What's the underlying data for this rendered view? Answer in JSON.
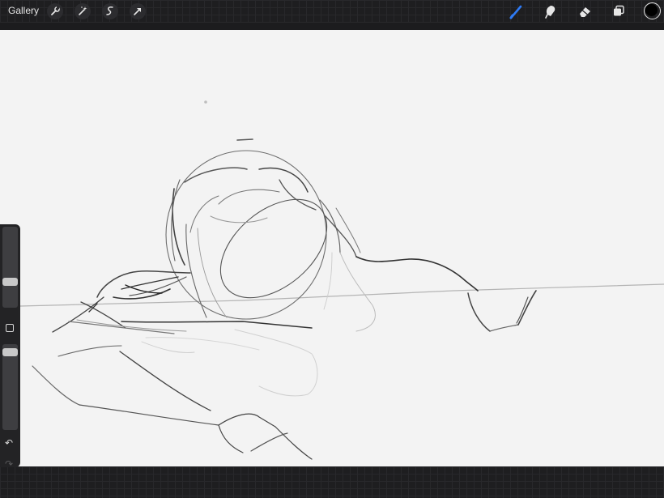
{
  "toolbar": {
    "gallery_label": "Gallery",
    "left_icons": [
      "wrench-icon",
      "magic-wand-icon",
      "selection-icon",
      "transform-arrow-icon"
    ],
    "right_icons": [
      "brush-icon",
      "smudge-icon",
      "eraser-icon",
      "layers-icon",
      "color-swatch"
    ]
  },
  "colors": {
    "active_tool": "#2f7bf5",
    "current_color": "#000000",
    "toolbar_bg": "#1e1e20",
    "canvas_bg": "#f3f3f3"
  },
  "sidebar": {
    "brush_size_level": 0.3,
    "opacity_level": 0.05,
    "undo_icon": "undo-icon",
    "redo_icon": "redo-icon",
    "modify_button": "modify-square-icon"
  }
}
